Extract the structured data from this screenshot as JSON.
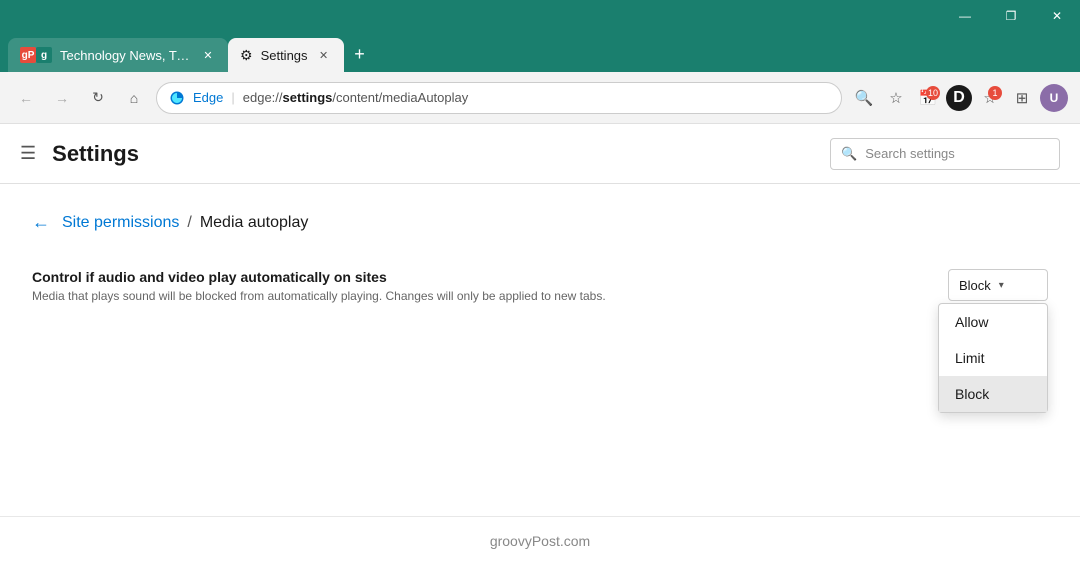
{
  "browser": {
    "title_bar_color": "#1a7f6e",
    "window_controls": {
      "minimize": "—",
      "restore": "❐",
      "close": "✕"
    }
  },
  "tabs": [
    {
      "id": "tab-news",
      "label": "Technology News, Tips, Reviews,",
      "favicon_text": "gP",
      "active": false,
      "close_label": "✕"
    },
    {
      "id": "tab-settings",
      "label": "Settings",
      "favicon_text": "⚙",
      "active": true,
      "close_label": "✕"
    }
  ],
  "tab_new_label": "+",
  "address_bar": {
    "back_label": "←",
    "forward_label": "→",
    "refresh_label": "↻",
    "home_label": "⌂",
    "edge_logo_text": "Edge",
    "separator": "|",
    "url_prefix": "edge://",
    "url_bold": "settings",
    "url_suffix": "/content/mediaAutoplay",
    "full_url": "edge://settings/content/mediaAutoplay"
  },
  "toolbar": {
    "search_icon": "🔍",
    "star_icon": "☆",
    "calendar_icon": "📅",
    "calendar_badge": "10",
    "d_icon": "D",
    "favorites_icon": "★",
    "favorites_badge": "1",
    "collections_icon": "⊞",
    "avatar_label": "U"
  },
  "settings": {
    "hamburger_label": "☰",
    "title": "Settings",
    "search_placeholder": "Search settings",
    "search_icon": "🔍"
  },
  "breadcrumb": {
    "back_label": "←",
    "link_text": "Site permissions",
    "separator": "/",
    "current_text": "Media autoplay"
  },
  "permission": {
    "title": "Control if audio and video play automatically on sites",
    "description": "Media that plays sound will be blocked from automatically playing. Changes will only be applied to new tabs.",
    "dropdown_selected": "Block",
    "dropdown_chevron": "▾",
    "options": [
      {
        "label": "Allow",
        "value": "allow"
      },
      {
        "label": "Limit",
        "value": "limit"
      },
      {
        "label": "Block",
        "value": "block",
        "selected": true
      }
    ]
  },
  "footer": {
    "text": "groovyPost.com"
  }
}
